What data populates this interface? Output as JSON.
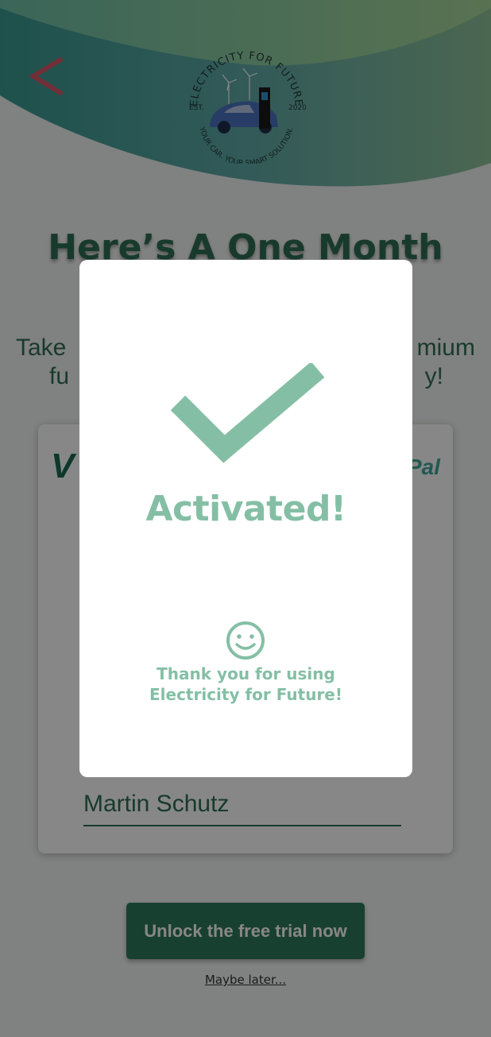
{
  "header": {
    "logo": {
      "arc_top": "ELECTRICITY FOR FUTURE",
      "arc_bottom": "YOUR CAR. YOUR SMART SOLUTION.",
      "est": "EST.",
      "year": "2020"
    }
  },
  "main": {
    "headline": "Here’s A One Month",
    "subtext_line1_left": "Take",
    "subtext_line1_right": "mium",
    "subtext_line2_left": "fu",
    "subtext_line2_right": "y!",
    "card": {
      "visa_fragment": "V",
      "paypal_fragment": "Pal",
      "name_value": "Martin Schutz"
    },
    "unlock_button_label": "Unlock the free trial now",
    "maybe_later_label": "Maybe later..."
  },
  "modal": {
    "title": "Activated!",
    "message_line1": "Thank you for using",
    "message_line2": "Electricity for Future!"
  },
  "colors": {
    "accent_dark": "#2f6e55",
    "accent_light": "#84bfa5",
    "overlay": "rgba(0,0,0,0.47)"
  }
}
